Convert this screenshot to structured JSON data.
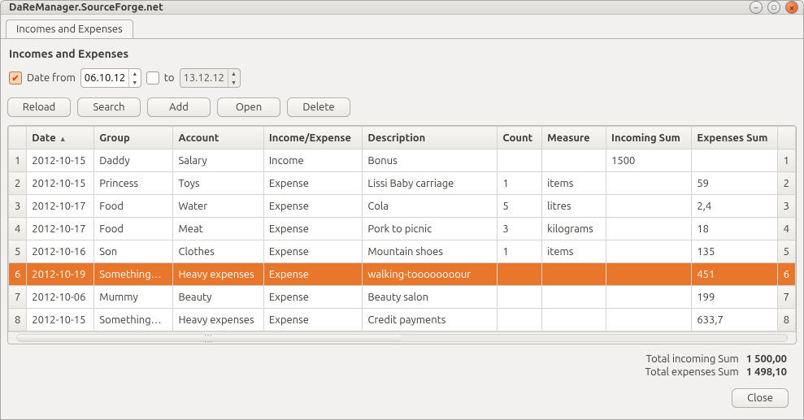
{
  "window": {
    "title": "DaReManager.SourceForge.net"
  },
  "tab": {
    "label": "Incomes and Expenses"
  },
  "heading": "Incomes and Expenses",
  "filter": {
    "date_from_label": "Date from",
    "date_from_value": "06.10.12",
    "to_label": "to",
    "date_to_value": "13.12.12"
  },
  "toolbar": {
    "reload": "Reload",
    "search": "Search",
    "add": "Add",
    "open": "Open",
    "delete": "Delete"
  },
  "columns": {
    "date": "Date",
    "group": "Group",
    "account": "Account",
    "ie": "Income/Expense",
    "desc": "Description",
    "count": "Count",
    "measure": "Measure",
    "incoming": "Incoming Sum",
    "expenses": "Expenses Sum"
  },
  "rows": [
    {
      "n": "1",
      "date": "2012-10-15",
      "group": "Daddy",
      "account": "Salary",
      "ie": "Income",
      "desc": "Bonus",
      "count": "",
      "measure": "",
      "inc": "1500",
      "exp": "",
      "id": "1"
    },
    {
      "n": "2",
      "date": "2012-10-15",
      "group": "Princess",
      "account": "Toys",
      "ie": "Expense",
      "desc": "Lissi Baby carriage",
      "count": "1",
      "measure": "items",
      "inc": "",
      "exp": "59",
      "id": "2"
    },
    {
      "n": "3",
      "date": "2012-10-17",
      "group": "Food",
      "account": "Water",
      "ie": "Expense",
      "desc": "Cola",
      "count": "5",
      "measure": "litres",
      "inc": "",
      "exp": "2,4",
      "id": "3"
    },
    {
      "n": "4",
      "date": "2012-10-17",
      "group": "Food",
      "account": "Meat",
      "ie": "Expense",
      "desc": "Pork to picnic",
      "count": "3",
      "measure": "kilograms",
      "inc": "",
      "exp": "18",
      "id": "4"
    },
    {
      "n": "5",
      "date": "2012-10-16",
      "group": "Son",
      "account": "Clothes",
      "ie": "Expense",
      "desc": "Mountain shoes",
      "count": "1",
      "measure": "items",
      "inc": "",
      "exp": "135",
      "id": "5"
    },
    {
      "n": "6",
      "date": "2012-10-19",
      "group": "Something…",
      "account": "Heavy expenses",
      "ie": "Expense",
      "desc": "walking-toooooooour",
      "count": "",
      "measure": "",
      "inc": "",
      "exp": "451",
      "id": "6"
    },
    {
      "n": "7",
      "date": "2012-10-06",
      "group": "Mummy",
      "account": "Beauty",
      "ie": "Expense",
      "desc": "Beauty salon",
      "count": "",
      "measure": "",
      "inc": "",
      "exp": "199",
      "id": "7"
    },
    {
      "n": "8",
      "date": "2012-10-15",
      "group": "Something…",
      "account": "Heavy expenses",
      "ie": "Expense",
      "desc": "Credit payments",
      "count": "",
      "measure": "",
      "inc": "",
      "exp": "633,7",
      "id": "8"
    }
  ],
  "selected_row": 5,
  "totals": {
    "incoming_label": "Total incoming Sum",
    "incoming_value": "1 500,00",
    "expenses_label": "Total expenses Sum",
    "expenses_value": "1 498,10"
  },
  "footer": {
    "close": "Close"
  }
}
